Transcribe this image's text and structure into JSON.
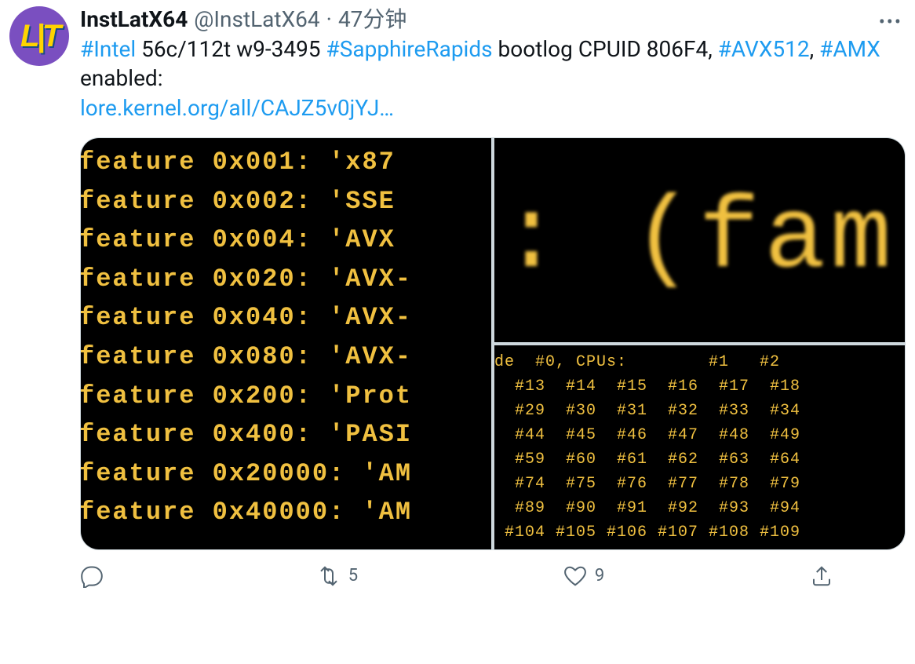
{
  "tweet": {
    "avatar_text": "L|T",
    "display_name": "InstLatX64",
    "handle": "@InstLatX64",
    "separator": "·",
    "time": "47分钟",
    "more": "•••",
    "body": {
      "parts": [
        {
          "t": "hashtag",
          "v": "#Intel"
        },
        {
          "t": "text",
          "v": " 56c/112t w9-3495 "
        },
        {
          "t": "hashtag",
          "v": "#SapphireRapids"
        },
        {
          "t": "text",
          "v": " bootlog CPUID 806F4, "
        },
        {
          "t": "hashtag",
          "v": "#AVX512"
        },
        {
          "t": "text",
          "v": ", "
        },
        {
          "t": "hashtag",
          "v": "#AMX"
        },
        {
          "t": "text",
          "v": " enabled:"
        },
        {
          "t": "br"
        },
        {
          "t": "link",
          "v": "lore.kernel.org/all/CAJZ5v0jYJ…"
        }
      ]
    },
    "media": {
      "panel_a_lines": [
        "feature 0x001: 'x87",
        "feature 0x002: 'SSE",
        "feature 0x004: 'AVX",
        "feature 0x020: 'AVX-",
        "feature 0x040: 'AVX-",
        "feature 0x080: 'AVX-",
        "feature 0x200: 'Prot",
        "feature 0x400: 'PASI",
        "feature 0x20000: 'AM",
        "feature 0x40000: 'AM"
      ],
      "panel_b_text": ": (fam",
      "panel_c_lines": [
        "de  #0, CPUs:        #1   #2",
        "  #13  #14  #15  #16  #17  #18 ",
        "  #29  #30  #31  #32  #33  #34",
        "  #44  #45  #46  #47  #48  #49",
        "  #59  #60  #61  #62  #63  #64",
        "  #74  #75  #76  #77  #78  #79",
        "  #89  #90  #91  #92  #93  #94",
        " #104 #105 #106 #107 #108 #109"
      ]
    },
    "actions": {
      "reply_count": "",
      "retweet_count": "5",
      "like_count": "9",
      "share_label": ""
    }
  }
}
